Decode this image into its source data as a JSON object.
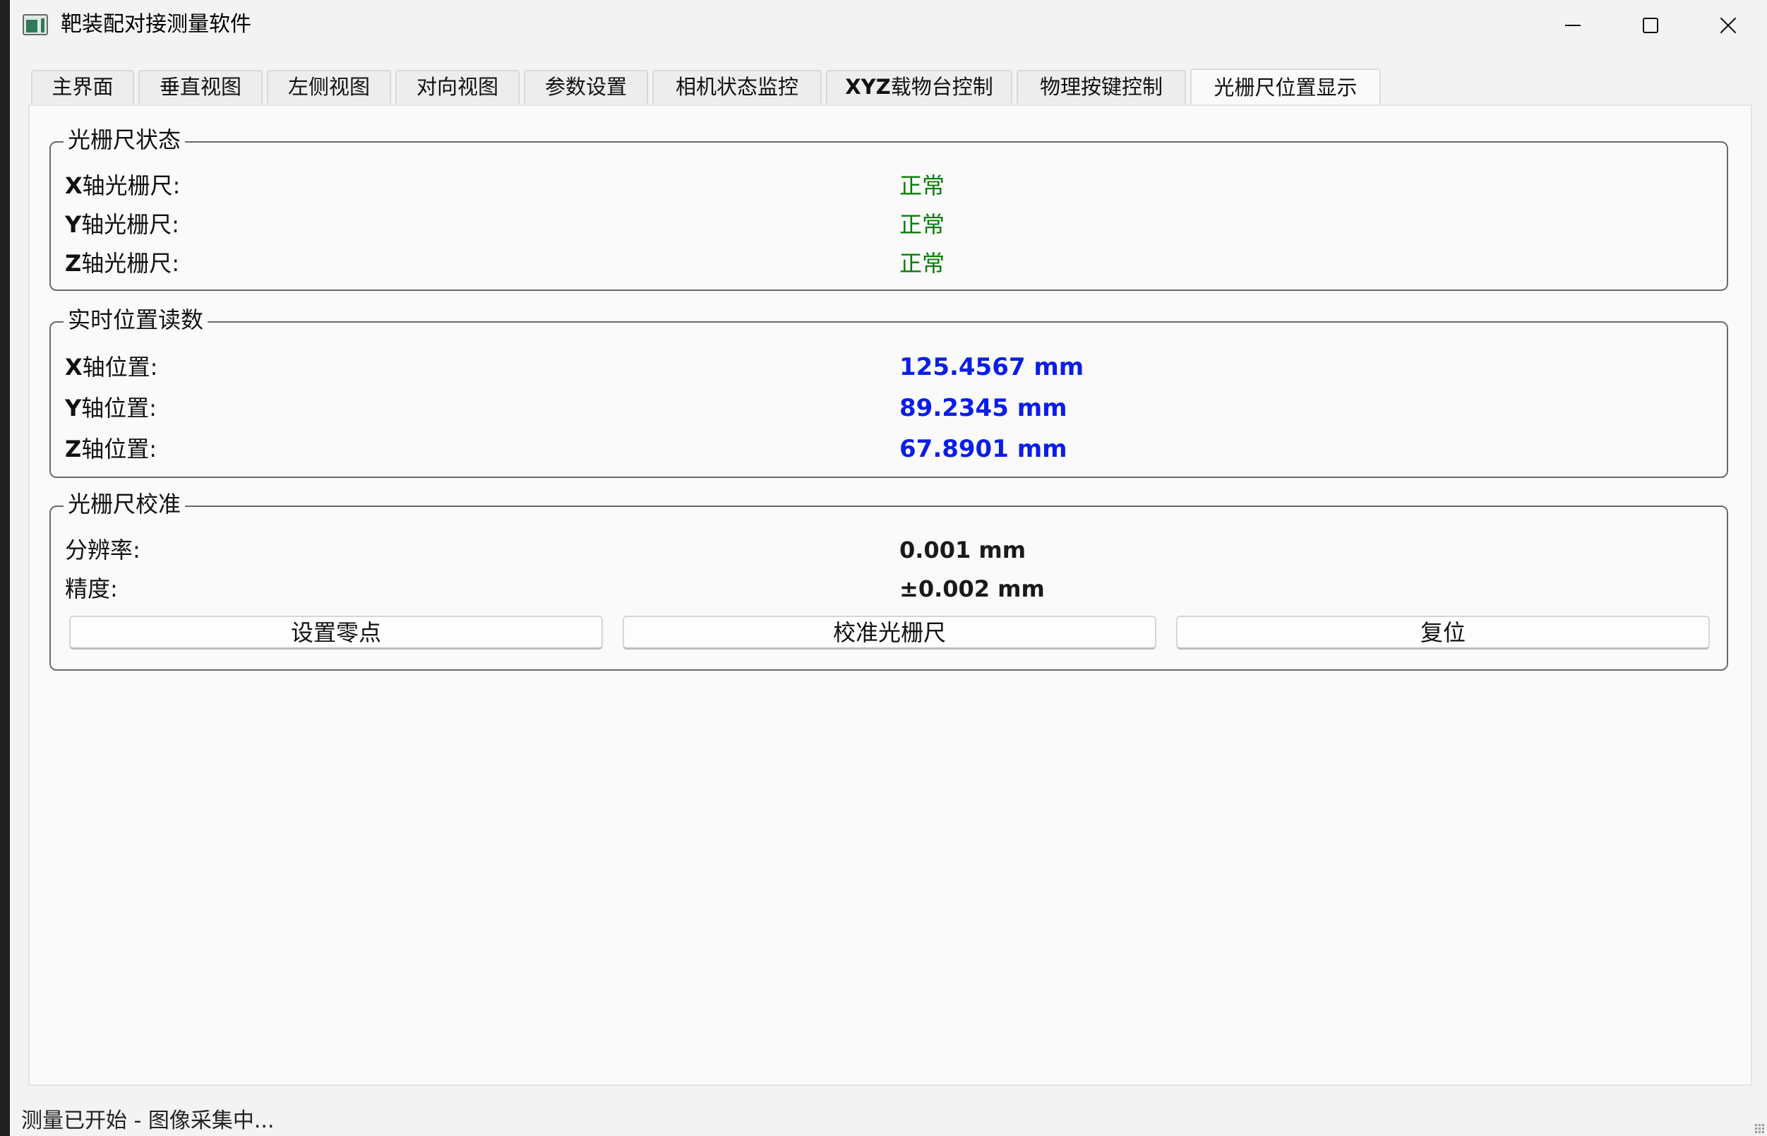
{
  "window": {
    "title": "靶装配对接测量软件"
  },
  "tabs": [
    {
      "label": "主界面"
    },
    {
      "label": "垂直视图"
    },
    {
      "label": "左侧视图"
    },
    {
      "label": "对向视图"
    },
    {
      "label": "参数设置"
    },
    {
      "label": "相机状态监控"
    },
    {
      "label_prefix": "XYZ",
      "label": "载物台控制"
    },
    {
      "label": "物理按键控制"
    },
    {
      "label": "光栅尺位置显示",
      "active": true
    }
  ],
  "status_group": {
    "title": "光栅尺状态",
    "rows": [
      {
        "axis": "X",
        "label": "轴光栅尺:",
        "value": "正常"
      },
      {
        "axis": "Y",
        "label": "轴光栅尺:",
        "value": "正常"
      },
      {
        "axis": "Z",
        "label": "轴光栅尺:",
        "value": "正常"
      }
    ],
    "ok_color": "#0a7d0a"
  },
  "position_group": {
    "title": "实时位置读数",
    "rows": [
      {
        "axis": "X",
        "label": "轴位置:",
        "value": "125.4567 mm"
      },
      {
        "axis": "Y",
        "label": "轴位置:",
        "value": "89.2345 mm"
      },
      {
        "axis": "Z",
        "label": "轴位置:",
        "value": "67.8901 mm"
      }
    ],
    "value_color": "#0b1ee6"
  },
  "calibration_group": {
    "title": "光栅尺校准",
    "resolution_label": "分辨率:",
    "resolution_value": "0.001 mm",
    "accuracy_label": "精度:",
    "accuracy_value": "±0.002 mm",
    "buttons": {
      "set_zero": "设置零点",
      "calibrate": "校准光栅尺",
      "reset": "复位"
    }
  },
  "statusbar": {
    "text": "测量已开始 - 图像采集中..."
  }
}
